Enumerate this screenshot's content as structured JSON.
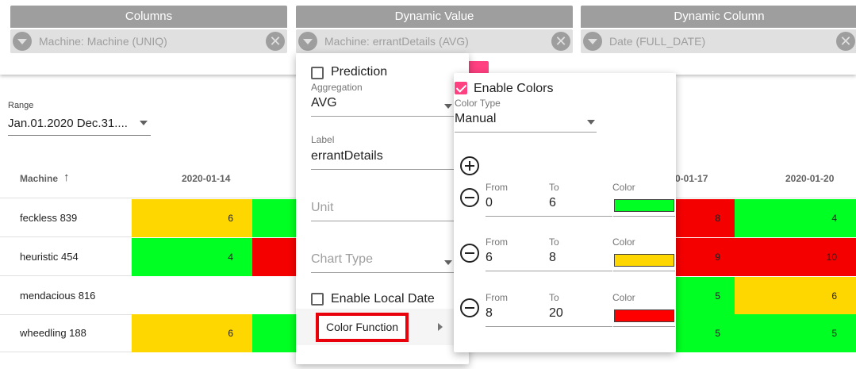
{
  "config": {
    "columns": {
      "header": "Columns",
      "chip": "Machine: Machine (UNIQ)"
    },
    "dynamic_value": {
      "header": "Dynamic Value",
      "chip": "Machine: errantDetails (AVG)"
    },
    "dynamic_column": {
      "header": "Dynamic Column",
      "chip": "Date (FULL_DATE)"
    },
    "remove_glyph": "✕"
  },
  "range": {
    "label": "Range",
    "value": "Jan.01.2020 Dec.31...."
  },
  "table": {
    "header_machine": "Machine",
    "sort_glyph": "↑",
    "dates": [
      "2020-01-14",
      "0-01-17",
      "2020-01-20"
    ],
    "rows": [
      {
        "name": "feckless 839",
        "c1": "6",
        "c4": "8",
        "c5": "4"
      },
      {
        "name": "heuristic 454",
        "c1": "4",
        "c4": "9",
        "c5": "10"
      },
      {
        "name": "mendacious 816",
        "c1": "",
        "c4": "5",
        "c5": "6"
      },
      {
        "name": "wheedling 188",
        "c1": "6",
        "c4": "5",
        "c5": "5"
      }
    ]
  },
  "menu": {
    "prediction": "Prediction",
    "aggregation_label": "Aggregation",
    "aggregation_value": "AVG",
    "label_label": "Label",
    "label_value": "errantDetails",
    "unit_placeholder": "Unit",
    "chart_type_placeholder": "Chart Type",
    "enable_local_date": "Enable Local Date",
    "color_function": "Color Function"
  },
  "color_menu": {
    "enable_colors": "Enable Colors",
    "color_type_label": "Color Type",
    "color_type_value": "Manual",
    "from_label": "From",
    "to_label": "To",
    "color_label": "Color",
    "ranges": [
      {
        "from": "0",
        "to": "6",
        "color": "#00ff22"
      },
      {
        "from": "6",
        "to": "8",
        "color": "#ffd700"
      },
      {
        "from": "8",
        "to": "20",
        "color": "#ff0000"
      }
    ]
  },
  "colors": {
    "green": "#00ff22",
    "yellow": "#ffd700",
    "red": "#f40000",
    "accent": "#ff4081",
    "highlight_border": "#e8000b"
  }
}
